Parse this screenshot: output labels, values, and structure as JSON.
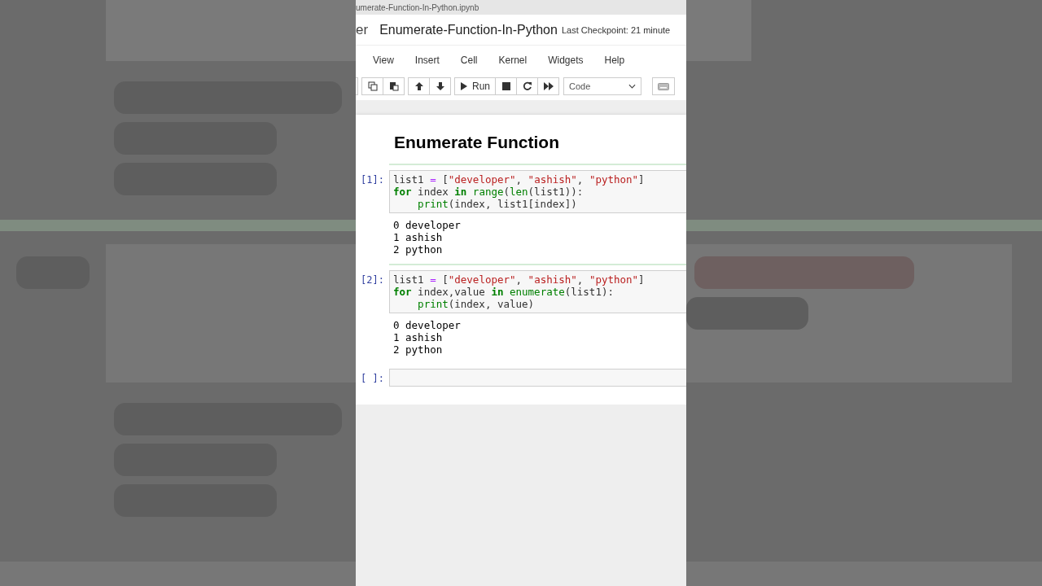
{
  "browser_tab": {
    "filename": "umerate-Function-In-Python.ipynb"
  },
  "header": {
    "logo_fragment": "er",
    "notebook_name": "Enumerate-Function-In-Python",
    "checkpoint": "Last Checkpoint: 21 minute"
  },
  "menu": [
    "View",
    "Insert",
    "Cell",
    "Kernel",
    "Widgets",
    "Help"
  ],
  "toolbar": {
    "run_label": "Run",
    "cell_type": "Code"
  },
  "heading": "Enumerate Function",
  "cells": [
    {
      "prompt": "[1]:",
      "lines": [
        [
          {
            "kind": "plain",
            "text": "list1 "
          },
          {
            "kind": "op",
            "text": "="
          },
          {
            "kind": "plain",
            "text": " ["
          },
          {
            "kind": "str",
            "text": "\"developer\""
          },
          {
            "kind": "plain",
            "text": ", "
          },
          {
            "kind": "str",
            "text": "\"ashish\""
          },
          {
            "kind": "plain",
            "text": ", "
          },
          {
            "kind": "str",
            "text": "\"python\""
          },
          {
            "kind": "plain",
            "text": "]"
          }
        ],
        [
          {
            "kind": "kw",
            "text": "for"
          },
          {
            "kind": "plain",
            "text": " index "
          },
          {
            "kind": "kw",
            "text": "in"
          },
          {
            "kind": "builtin",
            "text": " range"
          },
          {
            "kind": "plain",
            "text": "("
          },
          {
            "kind": "builtin",
            "text": "len"
          },
          {
            "kind": "plain",
            "text": "(list1)):"
          }
        ],
        [
          {
            "kind": "builtin",
            "text": "    print"
          },
          {
            "kind": "plain",
            "text": "(index, list1[index])"
          }
        ]
      ],
      "output": [
        "0 developer",
        "1 ashish",
        "2 python"
      ]
    },
    {
      "prompt": "[2]:",
      "lines": [
        [
          {
            "kind": "plain",
            "text": "list1 "
          },
          {
            "kind": "op",
            "text": "="
          },
          {
            "kind": "plain",
            "text": " ["
          },
          {
            "kind": "str",
            "text": "\"developer\""
          },
          {
            "kind": "plain",
            "text": ", "
          },
          {
            "kind": "str",
            "text": "\"ashish\""
          },
          {
            "kind": "plain",
            "text": ", "
          },
          {
            "kind": "str",
            "text": "\"python\""
          },
          {
            "kind": "plain",
            "text": "]"
          }
        ],
        [
          {
            "kind": "kw",
            "text": "for"
          },
          {
            "kind": "plain",
            "text": " index,value "
          },
          {
            "kind": "kw",
            "text": "in"
          },
          {
            "kind": "builtin",
            "text": " enumerate"
          },
          {
            "kind": "plain",
            "text": "(list1):"
          }
        ],
        [
          {
            "kind": "builtin",
            "text": "    print"
          },
          {
            "kind": "plain",
            "text": "(index, value)"
          }
        ]
      ],
      "output": [
        "0 developer",
        "1 ashish",
        "2 python"
      ]
    },
    {
      "prompt": "[ ]:"
    }
  ]
}
